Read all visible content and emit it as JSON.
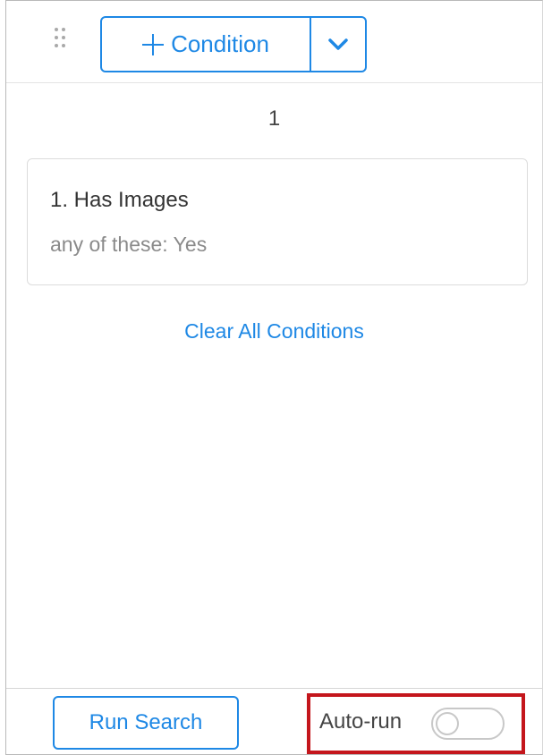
{
  "toolbar": {
    "add_condition_label": "Condition",
    "add_icon": "plus-icon",
    "dropdown_icon": "chevron-down-icon",
    "drag_icon": "drag-handle-icon",
    "accent_color": "#1e88e5"
  },
  "results": {
    "page_count": "1"
  },
  "conditions": [
    {
      "title": "1. Has Images",
      "detail": "any of these: Yes"
    }
  ],
  "clear_all_label": "Clear All Conditions",
  "footer": {
    "run_search_label": "Run Search",
    "auto_run_label": "Auto-run",
    "auto_run_enabled": false,
    "highlight_color": "#c4161c"
  }
}
